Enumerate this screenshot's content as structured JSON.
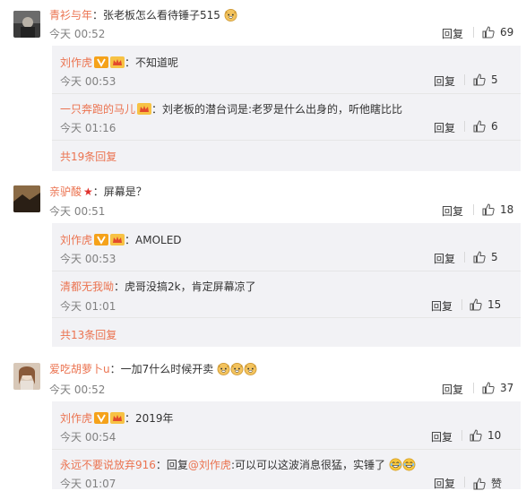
{
  "comments": [
    {
      "username": "青衫与年",
      "text": "：张老板怎么看待锤子515",
      "time": "今天 00:52",
      "reply_label": "回复",
      "likes": "69",
      "subcomments": [
        {
          "username": "刘作虎",
          "text": "：不知道呢",
          "time": "今天 00:53",
          "reply_label": "回复",
          "likes": "5"
        },
        {
          "username": "一只奔跑的马儿",
          "text": "：刘老板的潜台词是:老罗是什么出身的，听他瞎比比",
          "time": "今天 01:16",
          "reply_label": "回复",
          "likes": "6"
        }
      ],
      "more_label": "共19条回复"
    },
    {
      "username": "亲驴酸",
      "text": "：屏幕是？",
      "time": "今天 00:51",
      "reply_label": "回复",
      "likes": "18",
      "subcomments": [
        {
          "username": "刘作虎",
          "text": "：AMOLED",
          "time": "今天 00:53",
          "reply_label": "回复",
          "likes": "5"
        },
        {
          "username": "清都无我呦",
          "text": "：虎哥没搞2k，肯定屏幕凉了",
          "time": "今天 01:01",
          "reply_label": "回复",
          "likes": "15"
        }
      ],
      "more_label": "共13条回复"
    },
    {
      "username": "爱吃胡萝卜u",
      "text": "：一加7什么时候开卖",
      "time": "今天 00:52",
      "reply_label": "回复",
      "likes": "37",
      "subcomments": [
        {
          "username": "刘作虎",
          "text": "：2019年",
          "time": "今天 00:54",
          "reply_label": "回复",
          "likes": "10"
        },
        {
          "username": "永远不要说放弃916",
          "text": "：回复",
          "mention": "@刘作虎",
          "text2": ":可以可以这波消息很猛，实锤了",
          "time": "今天 01:07",
          "reply_label": "回复",
          "likes": "赞"
        }
      ]
    }
  ],
  "colors": {
    "username": "#eb7350",
    "subcomment_bg": "#f2f2f5",
    "time": "#808080",
    "badge": "#f5a21a",
    "star": "#e0312c"
  }
}
